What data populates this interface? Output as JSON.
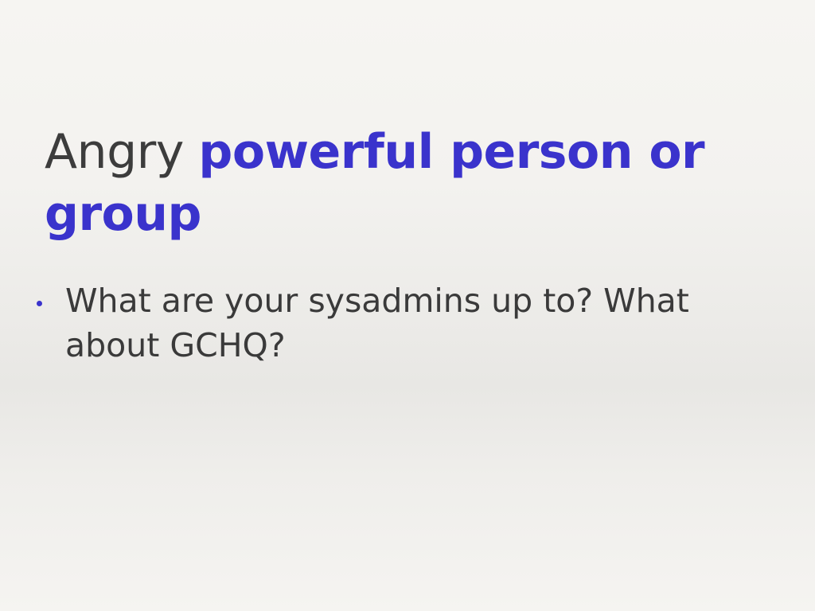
{
  "slide": {
    "title": {
      "plain": "Angry ",
      "accent": "powerful person or group"
    },
    "bullets": [
      {
        "text": "What are your sysadmins up to? What about GCHQ?"
      }
    ]
  },
  "colors": {
    "title_text": "#3c3c3c",
    "accent": "#3a33cc",
    "body_text": "#3a3a3a",
    "background": "#f3f2ef"
  }
}
